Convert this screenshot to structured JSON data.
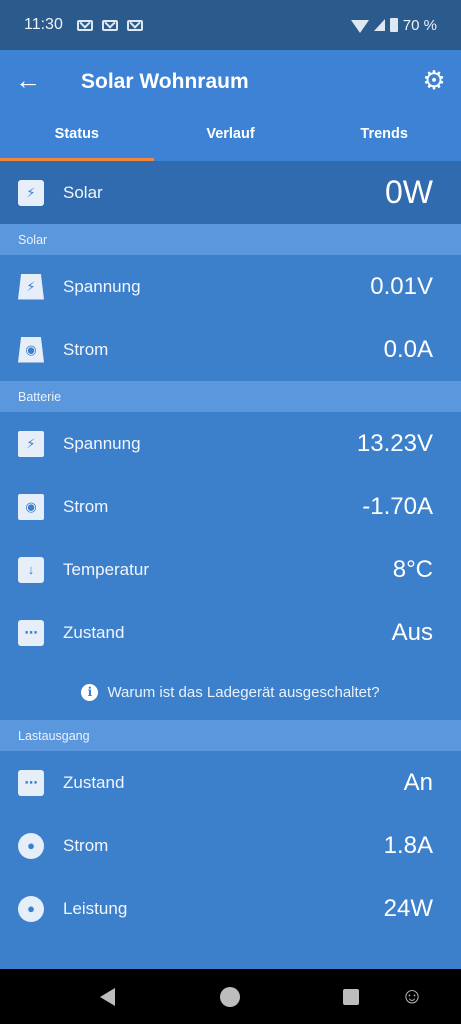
{
  "status_bar": {
    "time": "11:30",
    "battery": "70 %"
  },
  "header": {
    "title": "Solar Wohnraum"
  },
  "tabs": [
    {
      "label": "Status"
    },
    {
      "label": "Verlauf"
    },
    {
      "label": "Trends"
    }
  ],
  "hero": {
    "label": "Solar",
    "value": "0W"
  },
  "solar": {
    "section": "Solar",
    "rows": [
      {
        "label": "Spannung",
        "value": "0.01V"
      },
      {
        "label": "Strom",
        "value": "0.0A"
      }
    ]
  },
  "batterie": {
    "section": "Batterie",
    "rows": [
      {
        "label": "Spannung",
        "value": "13.23V"
      },
      {
        "label": "Strom",
        "value": "-1.70A"
      },
      {
        "label": "Temperatur",
        "value": "8°C"
      },
      {
        "label": "Zustand",
        "value": "Aus"
      }
    ],
    "info": "Warum ist das Ladegerät ausgeschaltet?"
  },
  "lastausgang": {
    "section": "Lastausgang",
    "rows": [
      {
        "label": "Zustand",
        "value": "An"
      },
      {
        "label": "Strom",
        "value": "1.8A"
      },
      {
        "label": "Leistung",
        "value": "24W"
      }
    ]
  },
  "icons": {
    "back": "arrow-left-icon",
    "settings": "gear-icon",
    "solar": "solar-panel-icon",
    "voltage": "lightning-icon",
    "current": "current-icon",
    "temperature": "thermometer-icon",
    "state": "dots-icon",
    "lightbulb": "lightbulb-icon",
    "info": "info-icon"
  },
  "colors": {
    "accent": "#f0873a",
    "appbar": "#3d82d4",
    "background": "#3c7fcb"
  }
}
